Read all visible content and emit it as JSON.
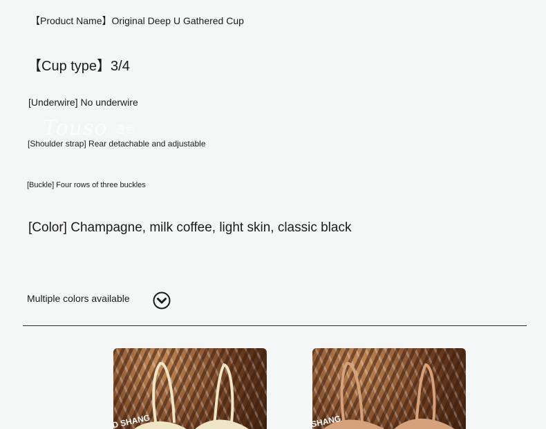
{
  "specs": {
    "product_name": "【Product Name】Original Deep U Gathered Cup",
    "cup_type": "【Cup type】3/4",
    "underwire": "[Underwire] No underwire",
    "shoulder_strap": "[Shoulder strap] Rear detachable and adjustable",
    "buckle": "[Buckle] Four rows of three buckles",
    "color": "[Color] Champagne, milk coffee, light skin, classic black"
  },
  "watermark": {
    "text": "Touso",
    "sub": "透色"
  },
  "colors_section": {
    "label": "Multiple colors available",
    "icon": "chevron-down-circle-icon"
  },
  "products": [
    {
      "color": "#ede4c6",
      "box_text": "D SHANG",
      "tone": "champagne"
    },
    {
      "color": "#d9a37c",
      "box_text": "SHANG",
      "tone": "light skin"
    }
  ]
}
